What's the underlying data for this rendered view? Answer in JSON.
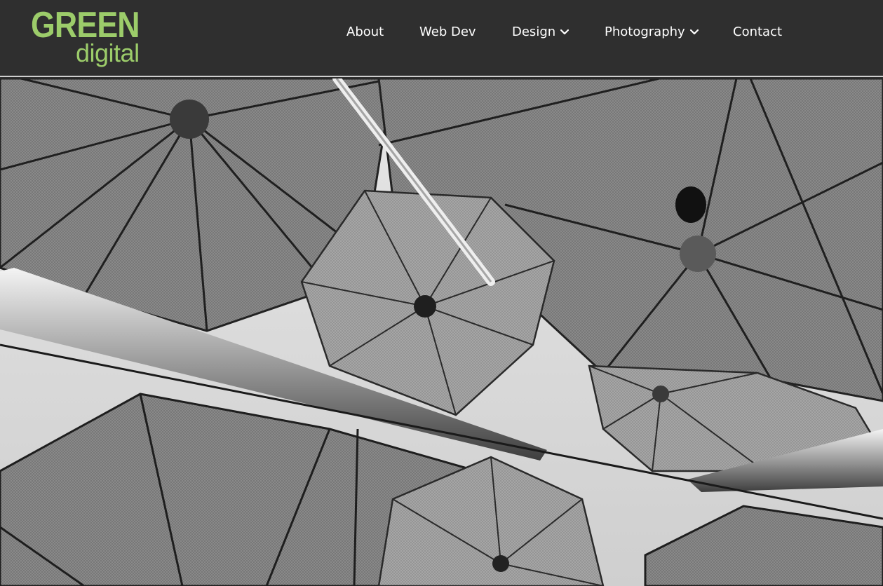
{
  "brand": {
    "logo_top": "GREEN",
    "logo_bottom": "digital",
    "logo_color": "#9ccc6a"
  },
  "nav": {
    "items": [
      {
        "label": "About",
        "has_dropdown": false
      },
      {
        "label": "Web Dev",
        "has_dropdown": false
      },
      {
        "label": "Design",
        "has_dropdown": true,
        "icon": "chevron-down-icon"
      },
      {
        "label": "Photography",
        "has_dropdown": true,
        "icon": "chevron-down-icon"
      },
      {
        "label": "Contact",
        "has_dropdown": false
      }
    ]
  },
  "colors": {
    "header_bg": "#2f2f2f",
    "nav_text": "#ffffff"
  },
  "hero": {
    "style": "black-and-white photo of suspended umbrella sculptures"
  }
}
